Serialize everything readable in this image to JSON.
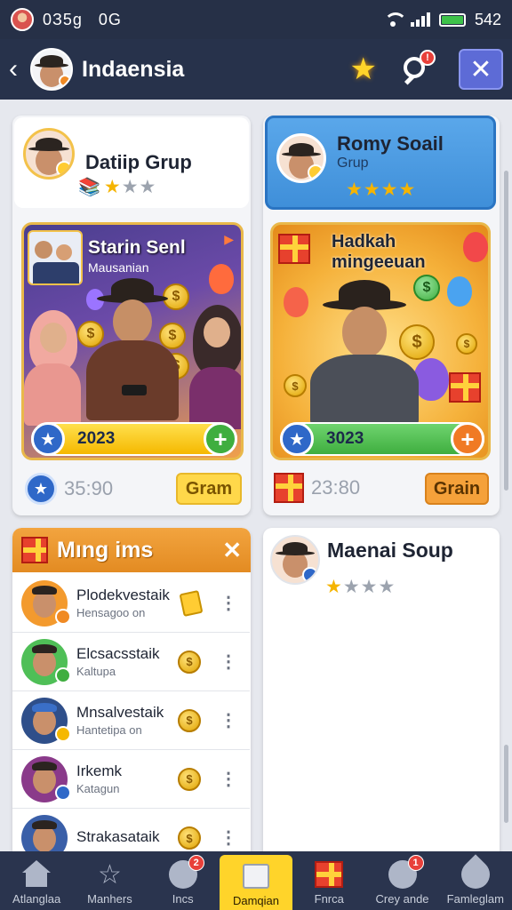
{
  "status_bar": {
    "left_text": "0З5g",
    "left_text2": "0G",
    "time": "542",
    "battery_level": 1.0
  },
  "header": {
    "title": "Indaensia",
    "search_badge": "!"
  },
  "groups": {
    "left": {
      "name": "Datiip Grup",
      "rating": 2,
      "rating_max": 4
    },
    "right": {
      "name": "Romy Soail",
      "subtitle": "Grup",
      "rating": 4,
      "rating_max": 4
    }
  },
  "promos": {
    "left": {
      "title": "Starin Senl",
      "subtitle": "Mausanian",
      "bar_value": "2023",
      "stat_value": "35:90",
      "button_label": "Gram"
    },
    "right": {
      "title_line1": "Hadkah",
      "title_line2": "mingeeuan",
      "bar_value": "3023",
      "stat_value": "23:80",
      "button_label": "Grain"
    }
  },
  "ming_list": {
    "title": "Mıng ims",
    "close_label": "✕",
    "items": [
      {
        "name": "Plodekvestaik",
        "sub": "Hensagoo on"
      },
      {
        "name": "Elcsacsstaik",
        "sub": "Kaltupa"
      },
      {
        "name": "Mnsalvestaik",
        "sub": "Hantetipa on"
      },
      {
        "name": "Irkemk",
        "sub": "Katagun"
      },
      {
        "name": "Strakasataik",
        "sub": ""
      }
    ]
  },
  "soup_card": {
    "name": "Maenai Soup",
    "rating": 1,
    "rating_max": 4
  },
  "bottom_nav": [
    {
      "label": "Atlanglaa",
      "icon": "home-icon",
      "badge": ""
    },
    {
      "label": "Manhers",
      "icon": "star-icon",
      "badge": ""
    },
    {
      "label": "Incs",
      "icon": "smile-icon",
      "badge": "2"
    },
    {
      "label": "Damqian",
      "icon": "box-icon",
      "badge": ""
    },
    {
      "label": "Fnrca",
      "icon": "gift-icon",
      "badge": ""
    },
    {
      "label": "Crey ande",
      "icon": "dots-icon",
      "badge": "1"
    },
    {
      "label": "Famleglam",
      "icon": "leaf-icon",
      "badge": ""
    }
  ],
  "colors": {
    "header_bg": "#27324b",
    "accent_blue": "#4aa3e8",
    "accent_orange": "#e38b22",
    "nav_active": "#ffd42a"
  }
}
